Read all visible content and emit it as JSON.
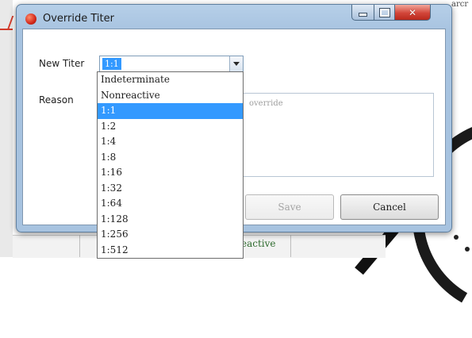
{
  "window": {
    "title": "Override Titer"
  },
  "form": {
    "new_titer_label": "New Titer",
    "new_titer_value": "1:1",
    "reason_label": "Reason",
    "reason_placeholder": "override"
  },
  "dropdown": {
    "options": [
      "Indeterminate",
      "Nonreactive",
      "1:1",
      "1:2",
      "1:4",
      "1:8",
      "1:16",
      "1:32",
      "1:64",
      "1:128",
      "1:256",
      "1:512"
    ],
    "selected": "1:1"
  },
  "buttons": {
    "save": "Save",
    "cancel": "Cancel"
  },
  "background": {
    "top_right_text": "arcr",
    "status_text": "eactive"
  },
  "colors": {
    "selection": "#3399ff",
    "close_button": "#d2463a"
  }
}
